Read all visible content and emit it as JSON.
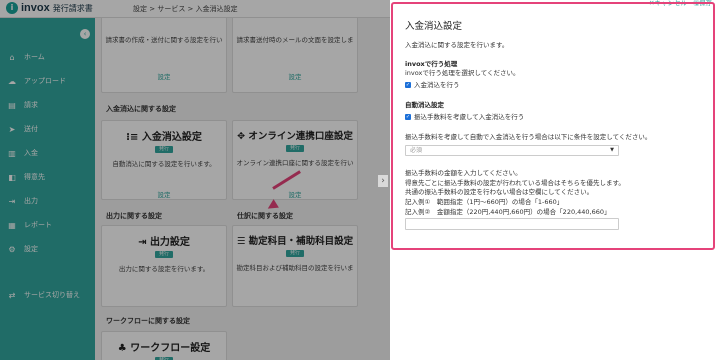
{
  "app": {
    "logo_mark": "i",
    "name": "invox",
    "subtitle": "発行請求書"
  },
  "breadcrumb": "設定 > サービス > 入金消込設定",
  "sidebar": {
    "collapse_icon": "‹",
    "items": [
      {
        "label": "ホーム",
        "icon": "⌂"
      },
      {
        "label": "アップロード",
        "icon": "☁"
      },
      {
        "label": "請求",
        "icon": "▤"
      },
      {
        "label": "送付",
        "icon": "➤"
      },
      {
        "label": "入金",
        "icon": "▥"
      },
      {
        "label": "得意先",
        "icon": "◧"
      },
      {
        "label": "出力",
        "icon": "⇥"
      },
      {
        "label": "レポート",
        "icon": "▦"
      },
      {
        "label": "設定",
        "icon": "⚙"
      },
      {
        "label": "サービス切り替え",
        "icon": "⇄"
      }
    ]
  },
  "main": {
    "top_cards": [
      {
        "desc": "請求書の作成・送付に関する設定を行い",
        "link": "設定"
      },
      {
        "desc": "請求書送付時のメールの文面を設定しま",
        "link": "設定"
      }
    ],
    "section_payment": "入金消込に関する設定",
    "payment_cards": [
      {
        "icon": "⁝≡",
        "title": "入金消込設定",
        "badge": "発行",
        "desc": "自動消込に関する設定を行います。",
        "link": "設定"
      },
      {
        "icon": "✥",
        "title": "オンライン連携口座設定",
        "badge": "発行",
        "desc": "オンライン連携口座に関する設定を行い",
        "link": "設定"
      }
    ],
    "section_output": "出力に関する設定",
    "section_journal": "仕訳に関する設定",
    "output_cards": [
      {
        "icon": "⇥",
        "title": "出力設定",
        "badge": "発行",
        "desc": "出力に関する設定を行います。"
      },
      {
        "icon": "☰",
        "title": "勘定科目・補助科目設定",
        "badge": "発行",
        "desc": "勘定科目および補助科目の設定を行いま"
      }
    ],
    "section_workflow": "ワークフローに関する設定",
    "workflow_card": {
      "icon": "♣",
      "title": "ワークフロー設定",
      "badge": "発行"
    },
    "expand_icon": "›"
  },
  "panel": {
    "top_actions": "✕キャンセル　🖫保存",
    "title": "入金消込設定",
    "description": "入金消込に関する設定を行います。",
    "invox_heading": "invoxで行う処理",
    "invox_desc": "invoxで行う処理を選択してください。",
    "invox_checkbox": "入金消込を行う",
    "auto_heading": "自動消込設定",
    "auto_checkbox": "振込手数料を考慮して入金消込を行う",
    "fee_condition_text": "振込手数料を考慮して自動で入金消込を行う場合は以下に条件を設定してください。",
    "select_placeholder": "必須",
    "fee_lines": [
      "振込手数料の金額を入力してください。",
      "得意先ごとに振込手数料の設定が行われている場合はそちらを優先します。",
      "共通の振込手数料の設定を行わない場合は空欄にしてください。",
      "記入例①　範囲指定（1円〜660円）の場合「1-660」",
      "記入例②　金額指定（220円,440円,660円）の場合「220,440,660」"
    ]
  }
}
